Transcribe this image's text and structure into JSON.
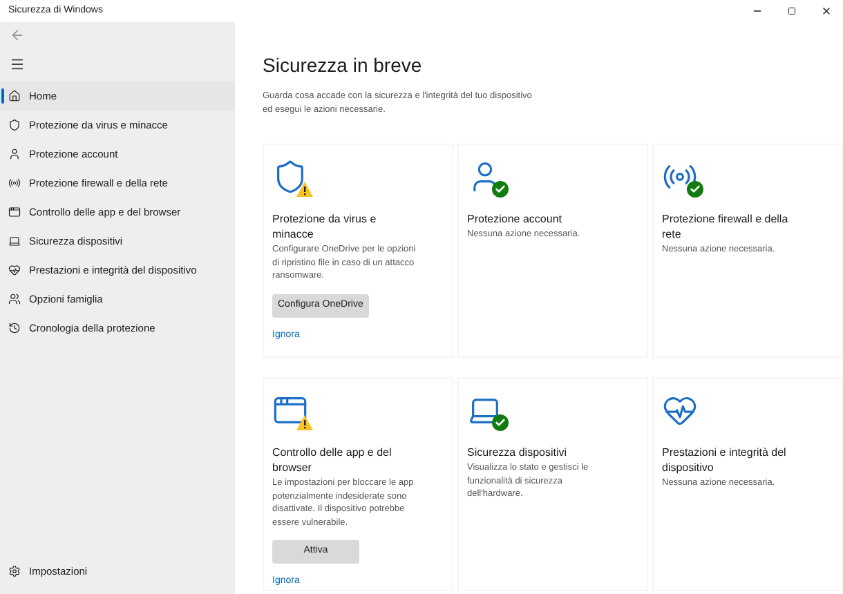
{
  "window": {
    "title": "Sicurezza di Windows"
  },
  "sidebar": {
    "items": [
      {
        "label": "Home",
        "selected": true
      },
      {
        "label": "Protezione da virus e minacce",
        "selected": false
      },
      {
        "label": "Protezione account",
        "selected": false
      },
      {
        "label": "Protezione firewall e della rete",
        "selected": false
      },
      {
        "label": "Controllo delle app e del browser",
        "selected": false
      },
      {
        "label": "Sicurezza dispositivi",
        "selected": false
      },
      {
        "label": "Prestazioni e integrità del dispositivo",
        "selected": false
      },
      {
        "label": "Opzioni famiglia",
        "selected": false
      },
      {
        "label": "Cronologia della protezione",
        "selected": false
      }
    ],
    "settings": "Impostazioni"
  },
  "main": {
    "title": "Sicurezza in breve",
    "subtitle": "Guarda cosa accade con la sicurezza e l'integrità del tuo dispositivo ed esegui le azioni necessarie.",
    "cards": [
      {
        "kind": "warning",
        "title": "Protezione da virus e minacce",
        "description": "Configurare OneDrive per le opzioni di ripristino file in caso di un attacco ransomware.",
        "button": "Configura OneDrive",
        "link": "Ignora"
      },
      {
        "kind": "ok",
        "title": "Protezione account",
        "description": "Nessuna azione necessaria."
      },
      {
        "kind": "ok",
        "title": "Protezione firewall e della rete",
        "description": "Nessuna azione necessaria."
      },
      {
        "kind": "warning",
        "title": "Controllo delle app e del browser",
        "description": "Le impostazioni per bloccare le app potenzialmente indesiderate sono disattivate. Il dispositivo potrebbe essere vulnerabile.",
        "button": "Attiva",
        "link": "Ignora"
      },
      {
        "kind": "ok",
        "title": "Sicurezza dispositivi",
        "description": "Visualizza lo stato e gestisci le funzionalità di sicurezza dell'hardware."
      },
      {
        "kind": "none",
        "title": "Prestazioni e integrità del dispositivo",
        "description": "Nessuna azione necessaria."
      }
    ]
  }
}
